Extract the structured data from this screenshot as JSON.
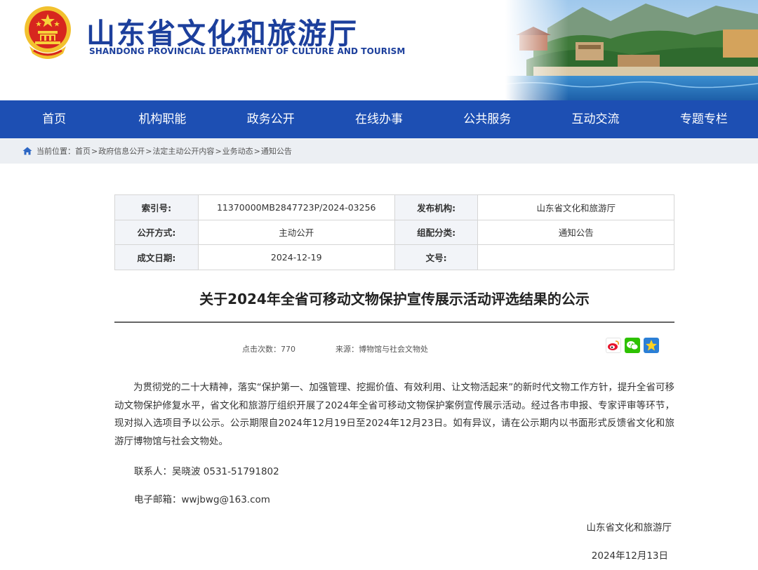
{
  "header": {
    "title": "山东省文化和旅游厅",
    "subtitle": "SHANDONG PROVINCIAL DEPARTMENT OF CULTURE AND TOURISM",
    "brand_color": "#1c3f9c"
  },
  "nav": {
    "background": "#1d4fb3",
    "items": [
      "首页",
      "机构职能",
      "政务公开",
      "在线办事",
      "公共服务",
      "互动交流",
      "专题专栏"
    ]
  },
  "breadcrumb": {
    "icon": "home-icon",
    "prefix": "当前位置：",
    "items": [
      "首页",
      "政府信息公开",
      "法定主动公开内容",
      "业务动态",
      "通知公告"
    ],
    "separator": ">"
  },
  "meta": {
    "rows": [
      {
        "k1": "索引号:",
        "v1": "11370000MB2847723P/2024-03256",
        "k2": "发布机构:",
        "v2": "山东省文化和旅游厅"
      },
      {
        "k1": "公开方式:",
        "v1": "主动公开",
        "k2": "组配分类:",
        "v2": "通知公告"
      },
      {
        "k1": "成文日期:",
        "v1": "2024-12-19",
        "k2": "文号:",
        "v2": ""
      }
    ]
  },
  "article": {
    "title": "关于2024年全省可移动文物保护宣传展示活动评选结果的公示",
    "views_label": "点击次数：",
    "views": "770",
    "source_label": "来源：",
    "source": "博物馆与社会文物处",
    "share_icons": [
      "weibo-icon",
      "wechat-icon",
      "qzone-icon"
    ],
    "body": "为贯彻党的二十大精神，落实“保护第一、加强管理、挖掘价值、有效利用、让文物活起来”的新时代文物工作方针，提升全省可移动文物保护修复水平，省文化和旅游厅组织开展了2024年全省可移动文物保护案例宣传展示活动。经过各市申报、专家评审等环节，现对拟入选项目予以公示。公示期限自2024年12月19日至2024年12月23日。如有异议，请在公示期内以书面形式反馈省文化和旅游厅博物馆与社会文物处。",
    "contact": "联系人：吴晓波  0531-51791802",
    "email": "电子邮箱：wwjbwg@163.com",
    "signature": "山东省文化和旅游厅",
    "date": "2024年12月13日"
  }
}
